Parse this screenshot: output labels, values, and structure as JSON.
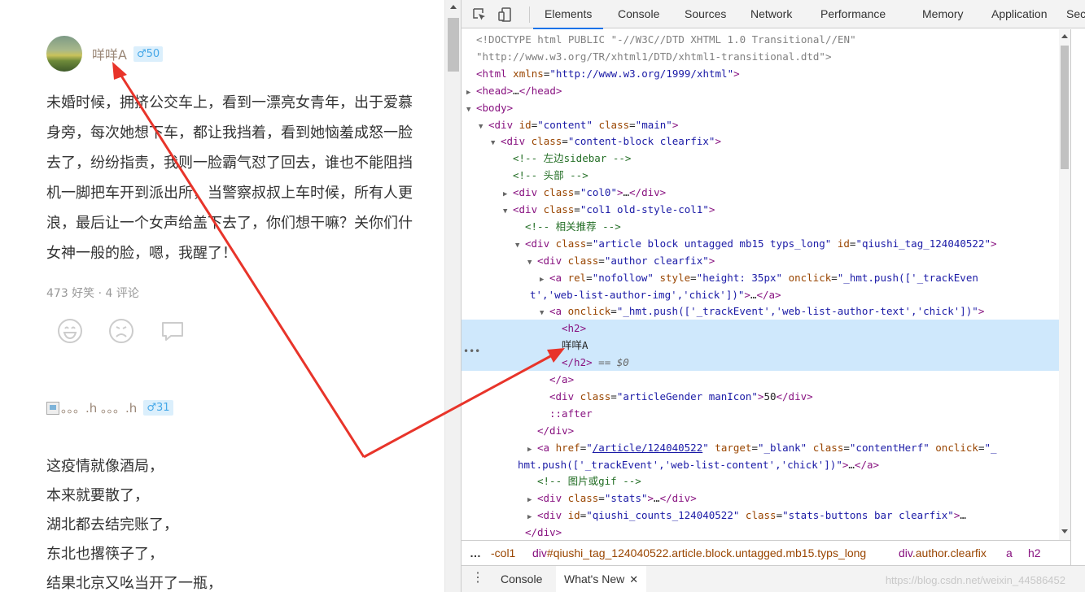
{
  "page": {
    "post1": {
      "author": "咩咩A",
      "gender_badge": "♂50",
      "lines": [
        "未婚时候，拥挤公交车上，看到一漂亮女青年，出于爱慕",
        "身旁，每次她想下车，都让我挡着，看到她恼羞成怒一脸",
        "去了，纷纷指责，我则一脸霸气怼了回去，谁也不能阻挡",
        "机一脚把车开到派出所，当警察叔叔上车时候，所有人更",
        "浪，最后让一个女声给盖下去了，你们想干嘛？关你们什",
        "女神一般的脸，嗯，我醒了！"
      ],
      "stats": "473 好笑 · 4 评论",
      "actions": [
        "smile-icon",
        "sad-icon",
        "comment-icon"
      ]
    },
    "post2": {
      "author": "。。。.h 。。。.h",
      "gender_badge": "♂31",
      "lines": [
        "这疫情就像酒局，",
        "本来就要散了，",
        "湖北都去结完账了，",
        "东北也撂筷子了，",
        "结果北京又吆当开了一瓶，"
      ]
    }
  },
  "devtools": {
    "tabs": [
      "Elements",
      "Console",
      "Sources",
      "Network",
      "Performance",
      "Memory",
      "Application",
      "Sec"
    ],
    "active_tab": "Elements",
    "dom_lines": [
      {
        "indent": 0,
        "html": "<span class='doc'>&lt;!DOCTYPE html PUBLIC \"-//W3C//DTD XHTML 1.0 Transitional//EN\"</span>"
      },
      {
        "indent": 0,
        "html": "<span class='doc'>\"http://www.w3.org/TR/xhtml1/DTD/xhtml1-transitional.dtd\"&gt;</span>"
      },
      {
        "indent": 0,
        "html": "<span class='tag'>&lt;html</span> <span class='attr'>xmlns</span>=<span class='val'>\"http://www.w3.org/1999/xhtml\"</span><span class='tag'>&gt;</span>"
      },
      {
        "indent": 0,
        "tri": "▶",
        "html": "<span class='tag'>&lt;head&gt;</span>…<span class='tag'>&lt;/head&gt;</span>"
      },
      {
        "indent": 0,
        "tri": "▼",
        "html": "<span class='tag'>&lt;body&gt;</span>"
      },
      {
        "indent": 1,
        "tri": "▼",
        "html": "<span class='tag'>&lt;div</span> <span class='attr'>id</span>=<span class='val'>\"content\"</span> <span class='attr'>class</span>=<span class='val'>\"main\"</span><span class='tag'>&gt;</span>"
      },
      {
        "indent": 2,
        "tri": "▼",
        "html": "<span class='tag'>&lt;div</span> <span class='attr'>class</span>=<span class='val'>\"content-block clearfix\"</span><span class='tag'>&gt;</span>"
      },
      {
        "indent": 3,
        "html": "<span class='cmt'>&lt;!-- 左边sidebar --&gt;</span>"
      },
      {
        "indent": 3,
        "html": "<span class='cmt'>&lt;!-- 头部 --&gt;</span>"
      },
      {
        "indent": 3,
        "tri": "▶",
        "html": "<span class='tag'>&lt;div</span> <span class='attr'>class</span>=<span class='val'>\"col0\"</span><span class='tag'>&gt;</span>…<span class='tag'>&lt;/div&gt;</span>"
      },
      {
        "indent": 3,
        "tri": "▼",
        "html": "<span class='tag'>&lt;div</span> <span class='attr'>class</span>=<span class='val'>\"col1 old-style-col1\"</span><span class='tag'>&gt;</span>"
      },
      {
        "indent": 4,
        "html": "<span class='cmt'>&lt;!-- 相关推荐 --&gt;</span>"
      },
      {
        "indent": 4,
        "tri": "▼",
        "html": "<span class='tag'>&lt;div</span> <span class='attr'>class</span>=<span class='val'>\"article block untagged mb15 typs_long\"</span> <span class='attr'>id</span>=<span class='val'>\"qiushi_tag_124040522\"</span><span class='tag'>&gt;</span>"
      },
      {
        "indent": 5,
        "tri": "▼",
        "html": "<span class='tag'>&lt;div</span> <span class='attr'>class</span>=<span class='val'>\"author clearfix\"</span><span class='tag'>&gt;</span>"
      },
      {
        "indent": 6,
        "tri": "▶",
        "html": "<span class='tag'>&lt;a</span> <span class='attr'>rel</span>=<span class='val'>\"nofollow\"</span> <span class='attr'>style</span>=<span class='val'>\"height: 35px\"</span> <span class='attr'>onclick</span>=<span class='val'>\"_hmt.push(['_trackEven</span>"
      },
      {
        "indent": 6,
        "cont": true,
        "html": "<span class='val'>t','web-list-author-img','chick'])\"</span><span class='tag'>&gt;</span>…<span class='tag'>&lt;/a&gt;</span>"
      },
      {
        "indent": 6,
        "tri": "▼",
        "html": "<span class='tag'>&lt;a</span> <span class='attr'>onclick</span>=<span class='val'>\"_hmt.push(['_trackEvent','web-list-author-text','chick'])\"</span><span class='tag'>&gt;</span>"
      },
      {
        "indent": 7,
        "sel": true,
        "html": "<span class='tag'>&lt;h2&gt;</span>"
      },
      {
        "indent": 7,
        "sel": true,
        "html": "咩咩A"
      },
      {
        "indent": 7,
        "sel": true,
        "html": "<span class='tag'>&lt;/h2&gt;</span> <span class='eq'>== $0</span>"
      },
      {
        "indent": 6,
        "html": "<span class='tag'>&lt;/a&gt;</span>"
      },
      {
        "indent": 6,
        "html": "<span class='tag'>&lt;div</span> <span class='attr'>class</span>=<span class='val'>\"articleGender manIcon\"</span><span class='tag'>&gt;</span>50<span class='tag'>&lt;/div&gt;</span>"
      },
      {
        "indent": 6,
        "html": "<span class='pseudo'>::after</span>"
      },
      {
        "indent": 5,
        "html": "<span class='tag'>&lt;/div&gt;</span>"
      },
      {
        "indent": 5,
        "tri": "▶",
        "html": "<span class='tag'>&lt;a</span> <span class='attr'>href</span>=<span class='val'>\"<span class='link'>/article/124040522</span>\"</span> <span class='attr'>target</span>=<span class='val'>\"_blank\"</span> <span class='attr'>class</span>=<span class='val'>\"contentHerf\"</span> <span class='attr'>onclick</span>=<span class='val'>\"_</span>"
      },
      {
        "indent": 5,
        "cont": true,
        "html": "<span class='val'>hmt.push(['_trackEvent','web-list-content','chick'])\"</span><span class='tag'>&gt;</span>…<span class='tag'>&lt;/a&gt;</span>"
      },
      {
        "indent": 5,
        "html": "<span class='cmt'>&lt;!-- 图片或gif --&gt;</span>"
      },
      {
        "indent": 5,
        "tri": "▶",
        "html": "<span class='tag'>&lt;div</span> <span class='attr'>class</span>=<span class='val'>\"stats\"</span><span class='tag'>&gt;</span>…<span class='tag'>&lt;/div&gt;</span>"
      },
      {
        "indent": 5,
        "tri": "▶",
        "html": "<span class='tag'>&lt;div</span> <span class='attr'>id</span>=<span class='val'>\"qiushi_counts_124040522\"</span> <span class='attr'>class</span>=<span class='val'>\"stats-buttons bar clearfix\"</span><span class='tag'>&gt;</span>…"
      },
      {
        "indent": 4,
        "html": "<span class='tag'>&lt;/div&gt;</span>"
      }
    ],
    "breadcrumbs": [
      {
        "tag": "",
        "cls": "-col1"
      },
      {
        "tag": "div",
        "cls": "#qiushi_tag_124040522.article.block.untagged.mb15.typs_long"
      },
      {
        "tag": "div",
        "cls": ".author.clearfix"
      },
      {
        "tag": "a",
        "cls": ""
      },
      {
        "tag": "h2",
        "cls": ""
      }
    ],
    "drawer_tabs": [
      "Console",
      "What's New"
    ],
    "watermark": "https://blog.csdn.net/weixin_44586452"
  }
}
